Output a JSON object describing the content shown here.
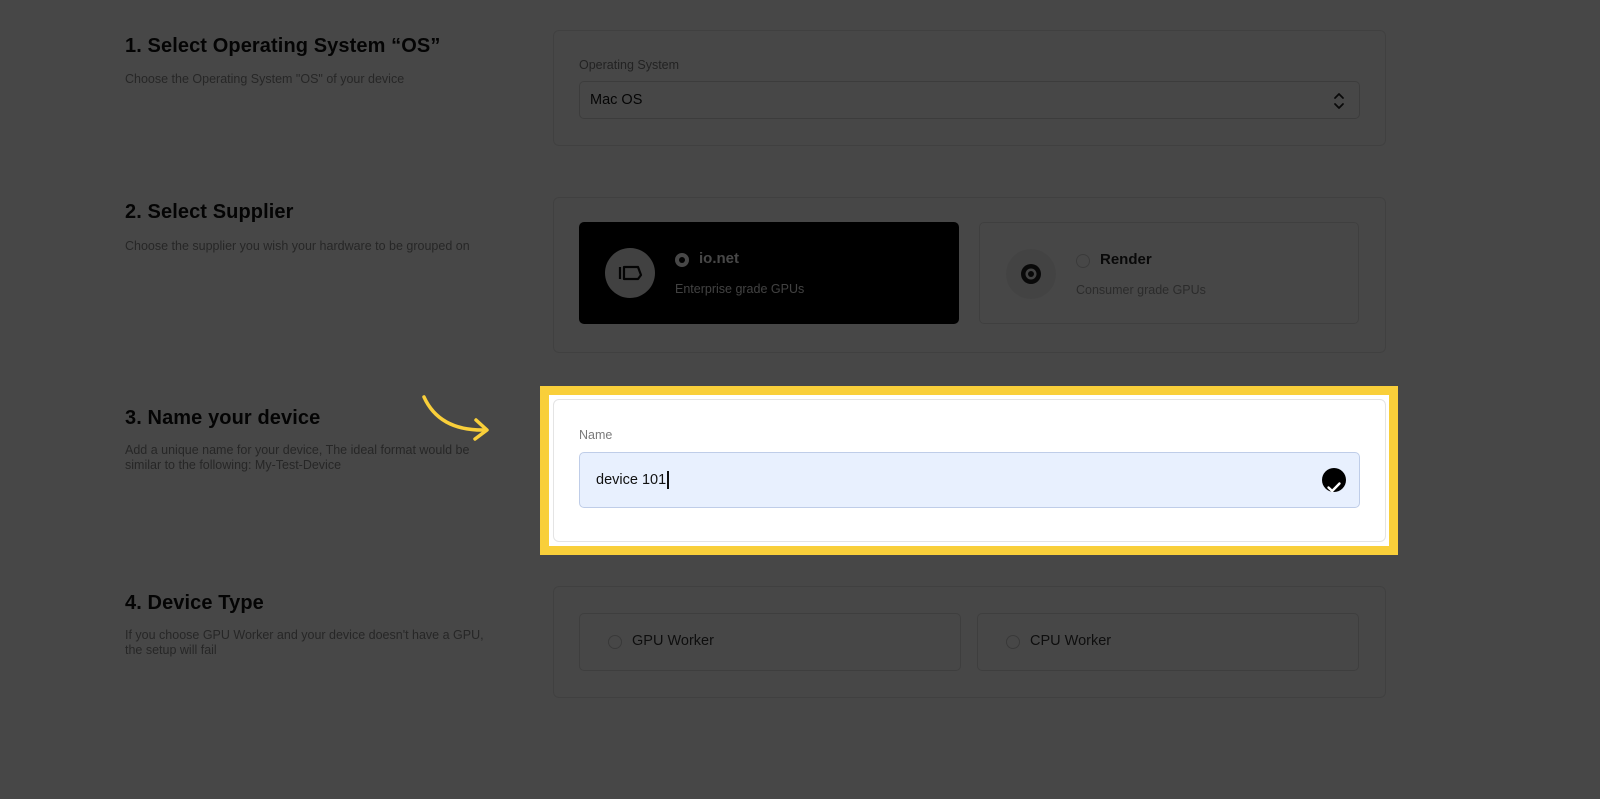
{
  "sections": {
    "os": {
      "title": "1. Select Operating System “OS”",
      "description": "Choose the Operating System \"OS\" of your device",
      "field_label": "Operating System",
      "selected_value": "Mac OS"
    },
    "supplier": {
      "title": "2. Select Supplier",
      "description": "Choose the supplier you wish your hardware to be grouped on",
      "options": [
        {
          "name": "io.net",
          "description": "Enterprise grade GPUs",
          "selected": true
        },
        {
          "name": "Render",
          "description": "Consumer grade GPUs",
          "selected": false
        }
      ]
    },
    "name": {
      "title": "3. Name your device",
      "description": "Add a unique name for your device, The ideal format would be similar to the following: My-Test-Device",
      "field_label": "Name",
      "value": "device 101"
    },
    "device_type": {
      "title": "4. Device Type",
      "description": "If you choose GPU Worker and your device doesn't have a GPU, the setup will fail",
      "options": [
        {
          "label": "GPU Worker",
          "selected": false
        },
        {
          "label": "CPU Worker",
          "selected": false
        }
      ]
    }
  },
  "colors": {
    "highlight": "#f9cf3a",
    "input_autofill_bg": "#e8f0fe",
    "overlay": "rgba(0,0,0,0.72)"
  },
  "icons": {
    "select": "chevron-up-down-icon",
    "valid": "checkmark-circle-icon",
    "annotation": "curved-arrow-icon"
  }
}
